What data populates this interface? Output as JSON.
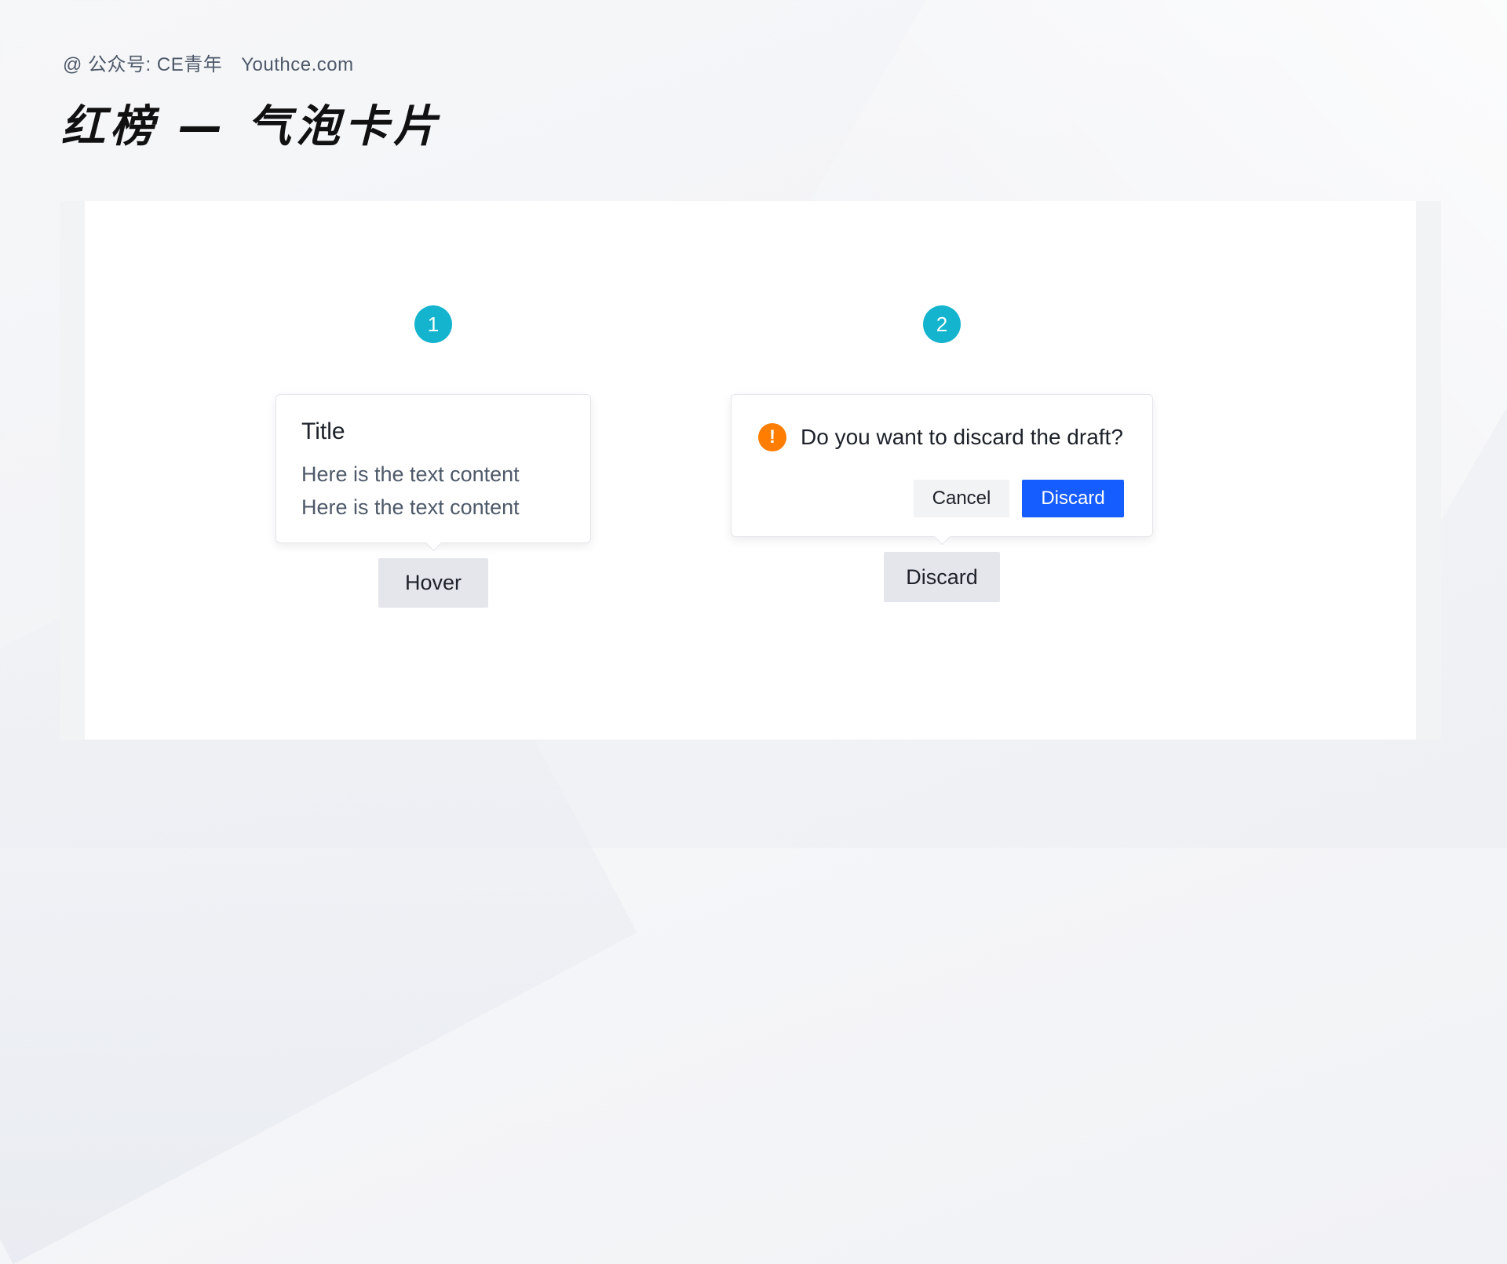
{
  "header": {
    "subtitle": "@ 公众号: CE青年",
    "site": "Youthce.com",
    "title": "红榜 — 气泡卡片"
  },
  "examples": [
    {
      "number": "1",
      "popover": {
        "title": "Title",
        "lines": [
          "Here is the text content",
          "Here is the text content"
        ]
      },
      "trigger_label": "Hover"
    },
    {
      "number": "2",
      "confirm": {
        "icon": "warning-circle-icon",
        "icon_glyph": "!",
        "message": "Do you want to discard the draft?",
        "cancel_label": "Cancel",
        "ok_label": "Discard"
      },
      "trigger_label": "Discard"
    }
  ],
  "colors": {
    "badge": "#14b4cf",
    "warning": "#ff7d00",
    "primary": "#165dff",
    "trigger_bg": "#e5e6eb",
    "cancel_bg": "#f2f3f5"
  }
}
